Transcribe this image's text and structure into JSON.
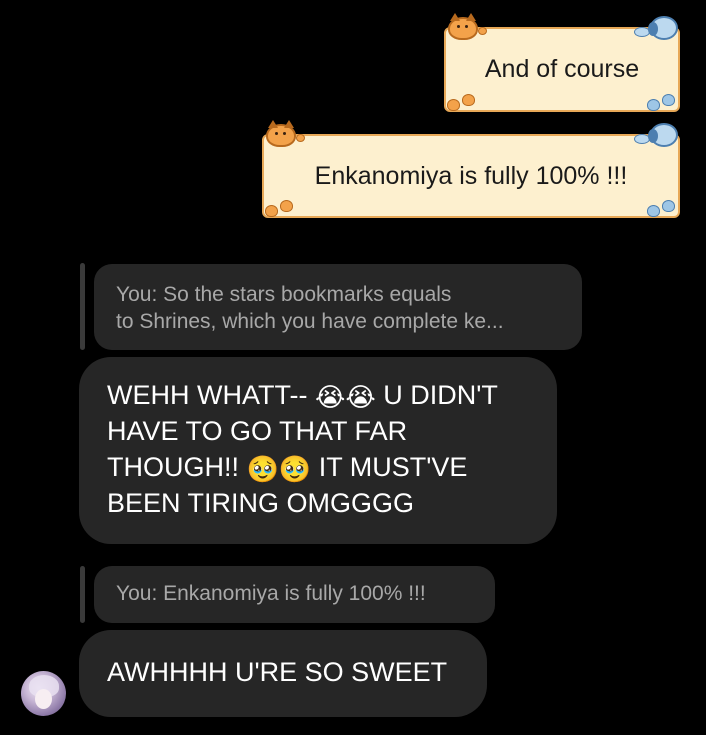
{
  "theme": {
    "background": "#000000",
    "sent_bubble_fill": "#fdf0cf",
    "sent_bubble_border": "#e7a857",
    "received_bubble_fill": "#262626",
    "reply_preview_fill": "#262626",
    "received_text_color": "#ffffff",
    "reply_text_color": "#a8a8a8"
  },
  "messages": [
    {
      "direction": "sent",
      "text": "And of course",
      "decorations": [
        "cat-icon",
        "dog-icon",
        "paw-icon"
      ]
    },
    {
      "direction": "sent",
      "text": "Enkanomiya is fully 100% !!!",
      "decorations": [
        "cat-icon",
        "dog-icon",
        "paw-icon"
      ]
    },
    {
      "direction": "received",
      "reply_preview": {
        "line1": "You: So the stars bookmarks equals",
        "line2": "to Shrines, which you have complete ke..."
      },
      "lines": [
        {
          "a": "WEHH WHATT-- ",
          "emoji": "😭😭",
          "b": " U DIDN'T"
        },
        {
          "text": "HAVE TO GO THAT FAR"
        },
        {
          "a": "THOUGH!! ",
          "emoji": "🥹🥹",
          "b": " IT MUST'VE"
        },
        {
          "text": "BEEN TIRING OMGGGG"
        }
      ]
    },
    {
      "direction": "received",
      "reply_preview": {
        "line1": "You: Enkanomiya is fully 100% !!!"
      },
      "text": "AWHHHH U'RE SO SWEET",
      "avatar": "contact-avatar"
    }
  ]
}
